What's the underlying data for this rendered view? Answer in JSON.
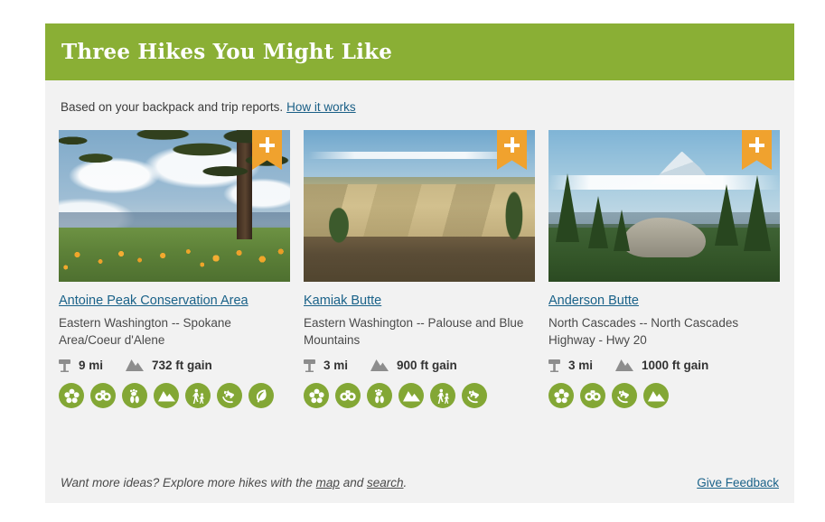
{
  "header": {
    "title": "Three Hikes You Might Like"
  },
  "subhead": {
    "text": "Based on your backpack and trip reports.",
    "link_label": "How it works"
  },
  "badge_add_label": "+",
  "cards": [
    {
      "title": "Antoine Peak Conservation Area",
      "region": "Eastern Washington -- Spokane Area/Coeur d'Alene",
      "distance": "9 mi",
      "gain": "732 ft gain",
      "photo": "wildflower-meadow-pine-photo",
      "features": [
        "flower-icon",
        "binoculars-icon",
        "paw-tracks-icon",
        "mountains-icon",
        "family-hikers-icon",
        "dog-icon",
        "leaf-icon"
      ]
    },
    {
      "title": "Kamiak Butte",
      "region": "Eastern Washington -- Palouse and Blue Mountains",
      "distance": "3 mi",
      "gain": "900 ft gain",
      "photo": "palouse-farmland-vista-photo",
      "features": [
        "flower-icon",
        "binoculars-icon",
        "paw-tracks-icon",
        "mountains-icon",
        "family-hikers-icon",
        "dog-icon"
      ]
    },
    {
      "title": "Anderson Butte",
      "region": "North Cascades -- North Cascades Highway - Hwy 20",
      "distance": "3 mi",
      "gain": "1000 ft gain",
      "photo": "north-cascades-peak-photo",
      "features": [
        "flower-icon",
        "binoculars-icon",
        "dog-icon",
        "mountains-icon"
      ]
    }
  ],
  "footer": {
    "prefix": "Want more ideas? Explore more hikes with the",
    "map_label": "map",
    "middle": "and",
    "search_label": "search",
    "suffix": ".",
    "feedback_label": "Give Feedback"
  },
  "colors": {
    "header_green": "#8aaf35",
    "badge_green": "#83a735",
    "ribbon_orange": "#f0a22e",
    "link_blue": "#1a6289",
    "panel_bg": "#f2f2f2"
  }
}
